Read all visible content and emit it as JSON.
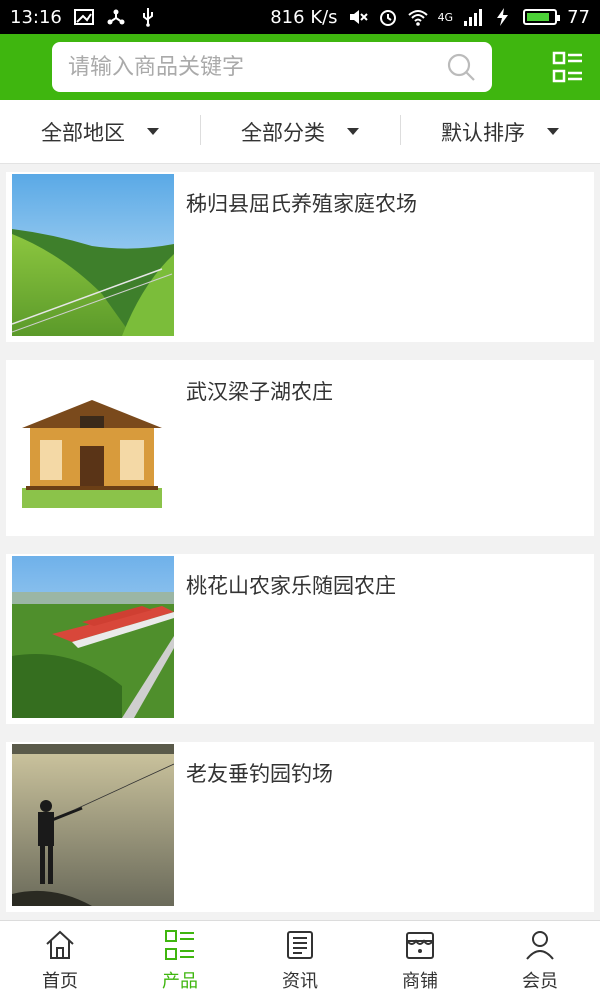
{
  "status_bar": {
    "time": "13:16",
    "net_speed": "816 K/s",
    "network": "4G",
    "battery": "77"
  },
  "search": {
    "placeholder": "请输入商品关键字"
  },
  "filters": [
    {
      "label": "全部地区"
    },
    {
      "label": "全部分类"
    },
    {
      "label": "默认排序"
    }
  ],
  "items": [
    {
      "title": "秭归县屈氏养殖家庭农场",
      "image": "grassland-farm-photo"
    },
    {
      "title": "武汉梁子湖农庄",
      "image": "wooden-pavilion-photo"
    },
    {
      "title": "桃花山农家乐随园农庄",
      "image": "farm-buildings-photo"
    },
    {
      "title": "老友垂钓园钓场",
      "image": "fishing-lake-photo"
    }
  ],
  "nav": [
    {
      "label": "首页",
      "icon": "home-icon"
    },
    {
      "label": "产品",
      "icon": "grid-list-icon",
      "active": true
    },
    {
      "label": "资讯",
      "icon": "news-icon"
    },
    {
      "label": "商铺",
      "icon": "store-icon"
    },
    {
      "label": "会员",
      "icon": "user-icon"
    }
  ],
  "colors": {
    "brand": "#3fb60f",
    "background": "#f2f2f2"
  }
}
